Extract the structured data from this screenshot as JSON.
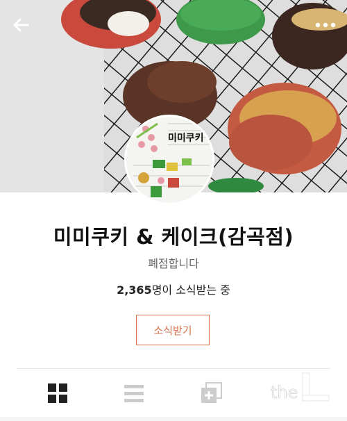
{
  "profile": {
    "name": "미미쿠키 & 케이크(감곡점)",
    "status": "폐점합니다",
    "subscriber_count": "2,365",
    "subscriber_suffix": "명이 소식받는 중",
    "subscribe_label": "소식받기"
  },
  "avatar_text": "미미쿠키",
  "watermark_text": "the",
  "colors": {
    "accent": "#d7734c",
    "tab_active": "#222222",
    "tab_inactive": "#cccccc"
  },
  "icons": {
    "back": "arrow-left",
    "more": "more-dots",
    "tab_grid": "grid",
    "tab_list": "list",
    "tab_album": "album-plus"
  }
}
